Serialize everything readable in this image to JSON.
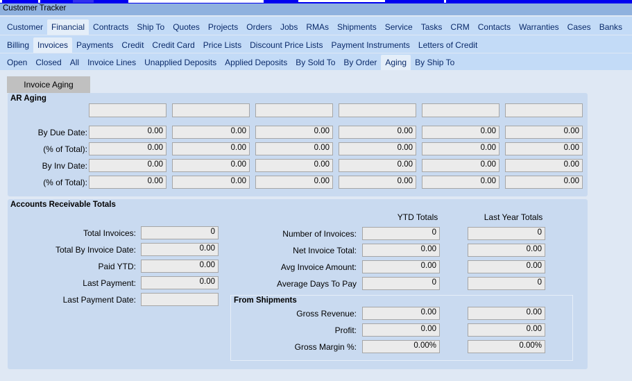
{
  "window": {
    "title": "Customer Tracker"
  },
  "tabs_main": [
    "Customer",
    "Financial",
    "Contracts",
    "Ship To",
    "Quotes",
    "Projects",
    "Orders",
    "Jobs",
    "RMAs",
    "Shipments",
    "Service",
    "Tasks",
    "CRM",
    "Contacts",
    "Warranties",
    "Cases",
    "Banks"
  ],
  "tabs_financial": [
    "Billing",
    "Invoices",
    "Payments",
    "Credit",
    "Credit Card",
    "Price Lists",
    "Discount Price Lists",
    "Payment Instruments",
    "Letters of Credit"
  ],
  "tabs_invoices": [
    "Open",
    "Closed",
    "All",
    "Invoice Lines",
    "Unapplied Deposits",
    "Applied Deposits",
    "By Sold To",
    "By Order",
    "Aging",
    "By Ship To"
  ],
  "section_tab": "Invoice Aging",
  "ar_aging": {
    "title": "AR Aging",
    "headers": [
      "",
      "",
      "",
      "",
      "",
      ""
    ],
    "rows": [
      {
        "label": "By Due Date:",
        "values": [
          "0.00",
          "0.00",
          "0.00",
          "0.00",
          "0.00",
          "0.00"
        ]
      },
      {
        "label": "(% of Total):",
        "values": [
          "0.00",
          "0.00",
          "0.00",
          "0.00",
          "0.00",
          "0.00"
        ]
      },
      {
        "label": "By Inv Date:",
        "values": [
          "0.00",
          "0.00",
          "0.00",
          "0.00",
          "0.00",
          "0.00"
        ]
      },
      {
        "label": "(% of Total):",
        "values": [
          "0.00",
          "0.00",
          "0.00",
          "0.00",
          "0.00",
          "0.00"
        ]
      }
    ]
  },
  "ar_totals": {
    "title": "Accounts Receivable Totals",
    "left": [
      {
        "label": "Total Invoices:",
        "value": "0"
      },
      {
        "label": "Total By Invoice Date:",
        "value": "0.00"
      },
      {
        "label": "Paid YTD:",
        "value": "0.00"
      },
      {
        "label": "Last Payment:",
        "value": "0.00"
      },
      {
        "label": "Last Payment Date:",
        "value": ""
      }
    ],
    "col_ytd": "YTD Totals",
    "col_last": "Last Year Totals",
    "right": [
      {
        "label": "Number of Invoices:",
        "ytd": "0",
        "last": "0"
      },
      {
        "label": "Net Invoice Total:",
        "ytd": "0.00",
        "last": "0.00"
      },
      {
        "label": "Avg Invoice Amount:",
        "ytd": "0.00",
        "last": "0.00"
      },
      {
        "label": "Average Days To Pay",
        "ytd": "0",
        "last": "0"
      }
    ],
    "shipments_title": "From Shipments",
    "shipments": [
      {
        "label": "Gross Revenue:",
        "ytd": "0.00",
        "last": "0.00"
      },
      {
        "label": "Profit:",
        "ytd": "0.00",
        "last": "0.00"
      },
      {
        "label": "Gross Margin %:",
        "ytd": "0.00%",
        "last": "0.00%"
      }
    ]
  }
}
